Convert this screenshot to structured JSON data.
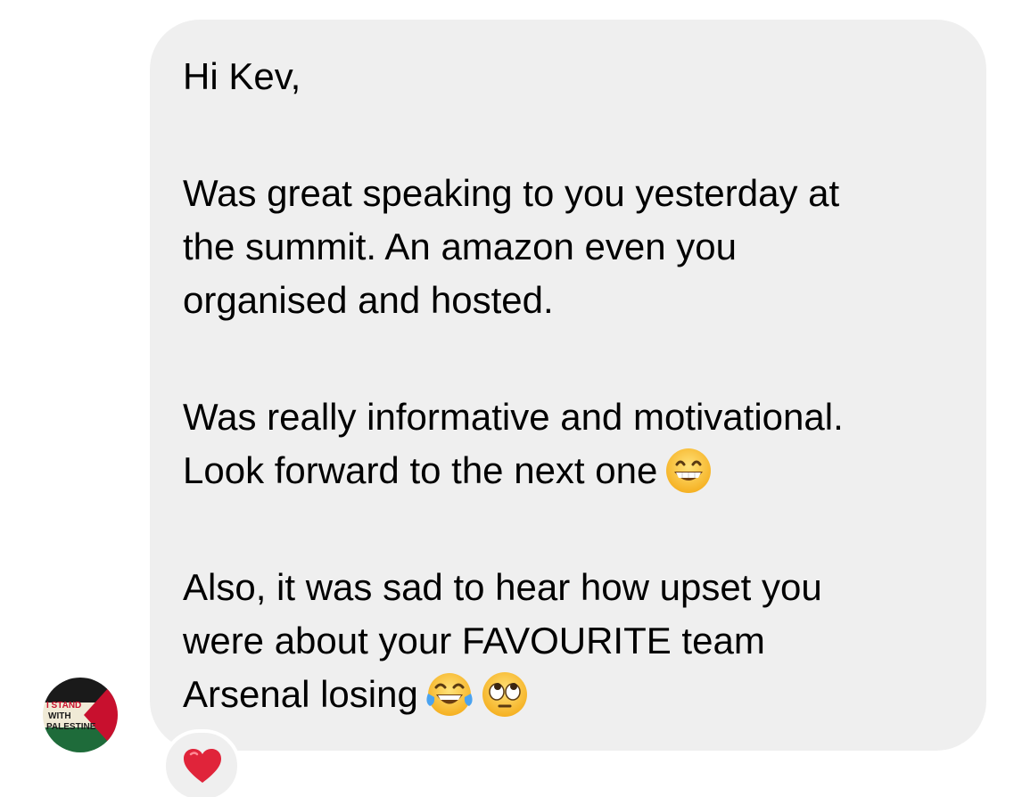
{
  "message": {
    "lines": [
      "Hi Kev,",
      "Was great speaking to you yesterday at",
      "the summit. An amazon even you",
      "organised and hosted.",
      "Was really informative and motivational.",
      "Look forward to the next one",
      "Also, it was sad to hear how upset you",
      "were about your FAVOURITE team",
      "Arsenal losing"
    ],
    "emojis": [
      "grinning-face-with-smiling-eyes",
      "face-with-tears-of-joy",
      "face-with-rolling-eyes"
    ],
    "bubble_color": "#efefef",
    "text_color": "#000000"
  },
  "avatar": {
    "text_lines": [
      "I STAND",
      "WITH",
      "PALESTINE"
    ],
    "colors": [
      "#1a1a1a",
      "#f0ead6",
      "#1e6b3a",
      "#c8102e"
    ]
  },
  "reaction": {
    "emoji": "red-heart",
    "color": "#e0243a"
  }
}
